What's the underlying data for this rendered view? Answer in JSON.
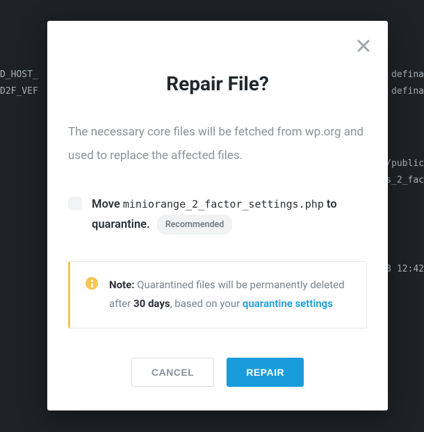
{
  "bg": {
    "t1": "D_HOST_",
    "t2": "D2F_VEF",
    "t3": "defina",
    "t4": "defina",
    "t5": "/public",
    "t6": "s_2_fac",
    "t7": "3 12:42"
  },
  "modal": {
    "title": "Repair File?",
    "description": "The necessary core files will be fetched from wp.org and used to replace the affected files.",
    "checkbox": {
      "move_prefix": "Move",
      "filename": "miniorange_2_factor_settings.php",
      "move_suffix_and_quarantine": "to quarantine.",
      "recommended": "Recommended"
    },
    "note": {
      "label": "Note:",
      "text1": " Quarantined files will be permanently deleted after ",
      "days": "30 days",
      "text2": ", based on your ",
      "link": "quarantine settings"
    },
    "buttons": {
      "cancel": "CANCEL",
      "repair": "REPAIR"
    }
  }
}
